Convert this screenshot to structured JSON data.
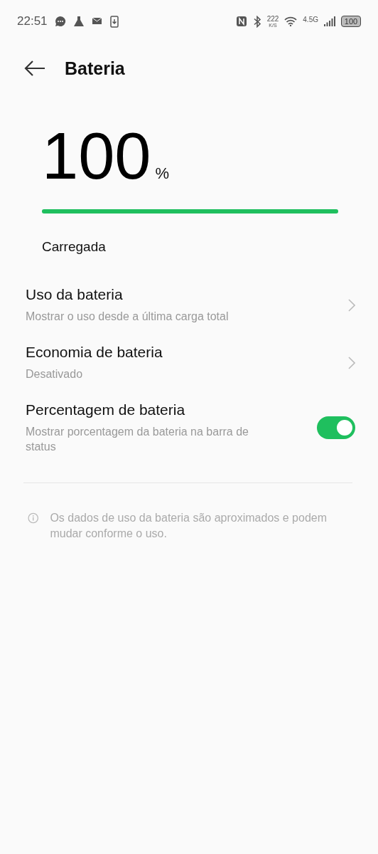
{
  "status_bar": {
    "time": "22:51",
    "speed": "222",
    "speed_unit": "K/S",
    "network": "4.5G",
    "battery": "100"
  },
  "header": {
    "title": "Bateria"
  },
  "battery": {
    "value": "100",
    "unit": "%",
    "level": 1,
    "state": "Carregada"
  },
  "settings": [
    {
      "kind": "link",
      "title": "Uso da bateria",
      "subtitle": "Mostrar o uso desde a última carga total"
    },
    {
      "kind": "link",
      "title": "Economia de bateria",
      "subtitle": "Desativado"
    },
    {
      "kind": "switch",
      "title": "Percentagem de bateria",
      "subtitle": "Mostrar porcentagem da bateria na barra de status",
      "on": true
    }
  ],
  "note": "Os dados de uso da bateria são aproximados e podem mudar conforme o uso."
}
